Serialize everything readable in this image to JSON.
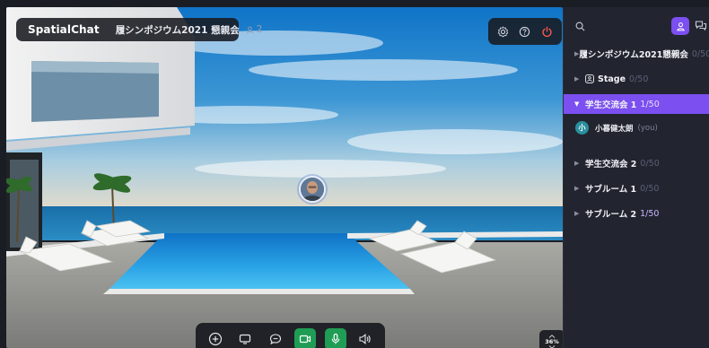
{
  "brand": {
    "name": "SpatialChat"
  },
  "room": {
    "title": "履シンポジウム2021 懇親会",
    "participants": "2"
  },
  "top_controls": [
    "settings-icon",
    "help-icon",
    "power-icon"
  ],
  "toolbar": {
    "buttons": [
      "add-icon",
      "screen-share-icon",
      "chat-icon",
      "camera-icon",
      "microphone-icon",
      "speaker-icon"
    ],
    "zoom": "36%"
  },
  "sidebar": {
    "rooms": [
      {
        "name": "履シンポジウム2021懇親会",
        "count": "0/50"
      },
      {
        "name": "Stage",
        "count": "0/50"
      },
      {
        "name": "学生交流会 1",
        "count": "1/50"
      },
      {
        "name": "学生交流会 2",
        "count": "0/50"
      },
      {
        "name": "サブルーム 1",
        "count": "0/50"
      },
      {
        "name": "サブルーム 2",
        "count": "1/50"
      }
    ],
    "member": {
      "initial": "小",
      "name": "小暮健太朗",
      "you": "(you)"
    }
  },
  "colors": {
    "accent": "#7b4ff0",
    "green": "#1f9d55",
    "panel": "#222530"
  }
}
